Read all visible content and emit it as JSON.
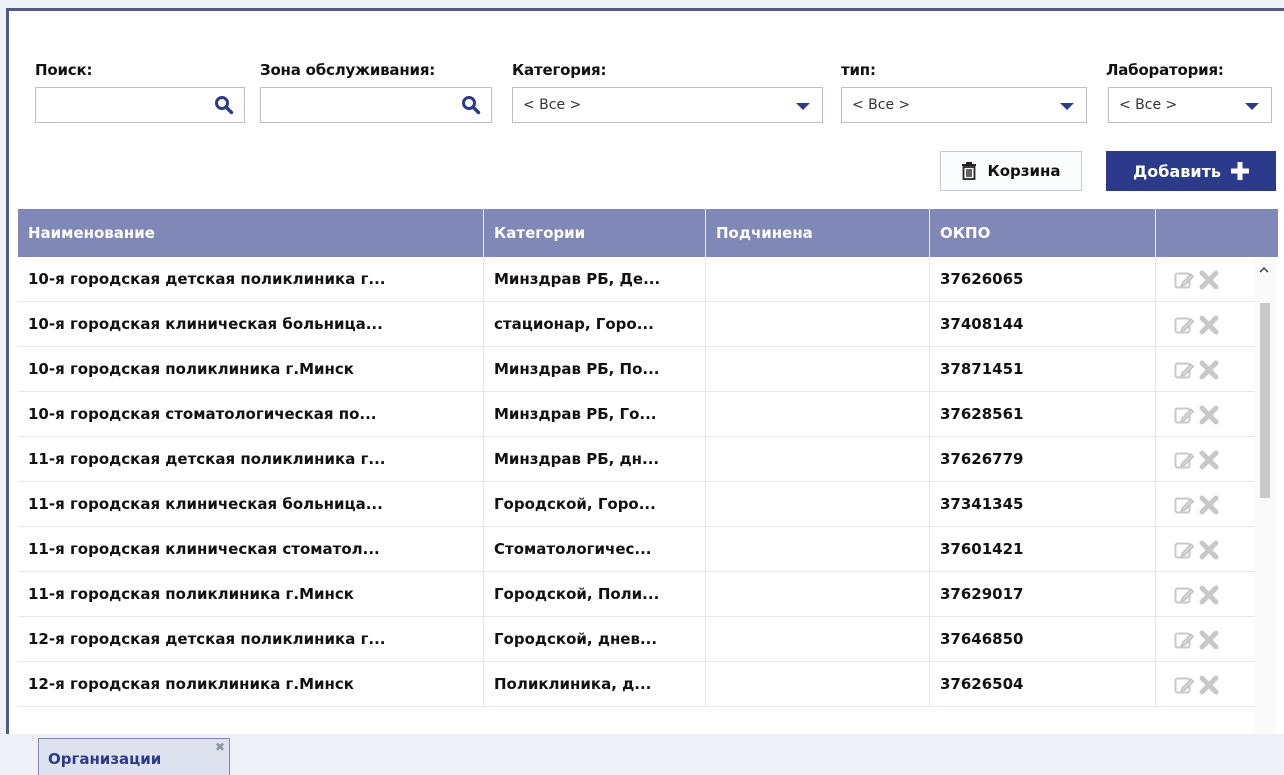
{
  "filters": {
    "search_label": "Поиск:",
    "search_value": "",
    "zone_label": "Зона обслуживания:",
    "zone_value": "",
    "category_label": "Категория:",
    "category_value": "< Все >",
    "type_label": "тип:",
    "type_value": "< Все >",
    "lab_label": "Лаборатория:",
    "lab_value": "< Все >"
  },
  "toolbar": {
    "trash_label": "Корзина",
    "add_label": "Добавить"
  },
  "table": {
    "columns": [
      "Наименование",
      "Категории",
      "Подчинена",
      "ОКПО",
      ""
    ],
    "rows": [
      [
        "10-я городская детская поликлиника г...",
        "Минздрав РБ, Де...",
        "",
        "37626065"
      ],
      [
        "10-я городская клиническая больница...",
        "стационар, Горо...",
        "",
        "37408144"
      ],
      [
        "10-я городская поликлиника г.Минск",
        "Минздрав РБ, По...",
        "",
        "37871451"
      ],
      [
        "10-я городская стоматологическая по...",
        "Минздрав РБ, Го...",
        "",
        "37628561"
      ],
      [
        "11-я городская детская поликлиника г...",
        "Минздрав РБ, дн...",
        "",
        "37626779"
      ],
      [
        "11-я городская клиническая больница...",
        "Городской, Горо...",
        "",
        "37341345"
      ],
      [
        "11-я городская клиническая стоматол...",
        "Стоматологичес...",
        "",
        "37601421"
      ],
      [
        "11-я городская поликлиника г.Минск",
        "Городской, Поли...",
        "",
        "37629017"
      ],
      [
        "12-я городская детская поликлиника г...",
        "Городской, днев...",
        "",
        "37646850"
      ],
      [
        "12-я городская поликлиника г.Минск",
        "Поликлиника, д...",
        "",
        "37626504"
      ]
    ]
  },
  "tabs": [
    {
      "label": "Организации",
      "close": "✖"
    }
  ],
  "icons": {
    "search": "search-icon",
    "trash": "trash-icon",
    "add": "plus-icon",
    "edit": "edit-icon",
    "delete": "delete-icon"
  },
  "colors": {
    "accent": "#2c3a8c",
    "header_bg": "#8088b8",
    "frame": "#4f5a8a"
  }
}
